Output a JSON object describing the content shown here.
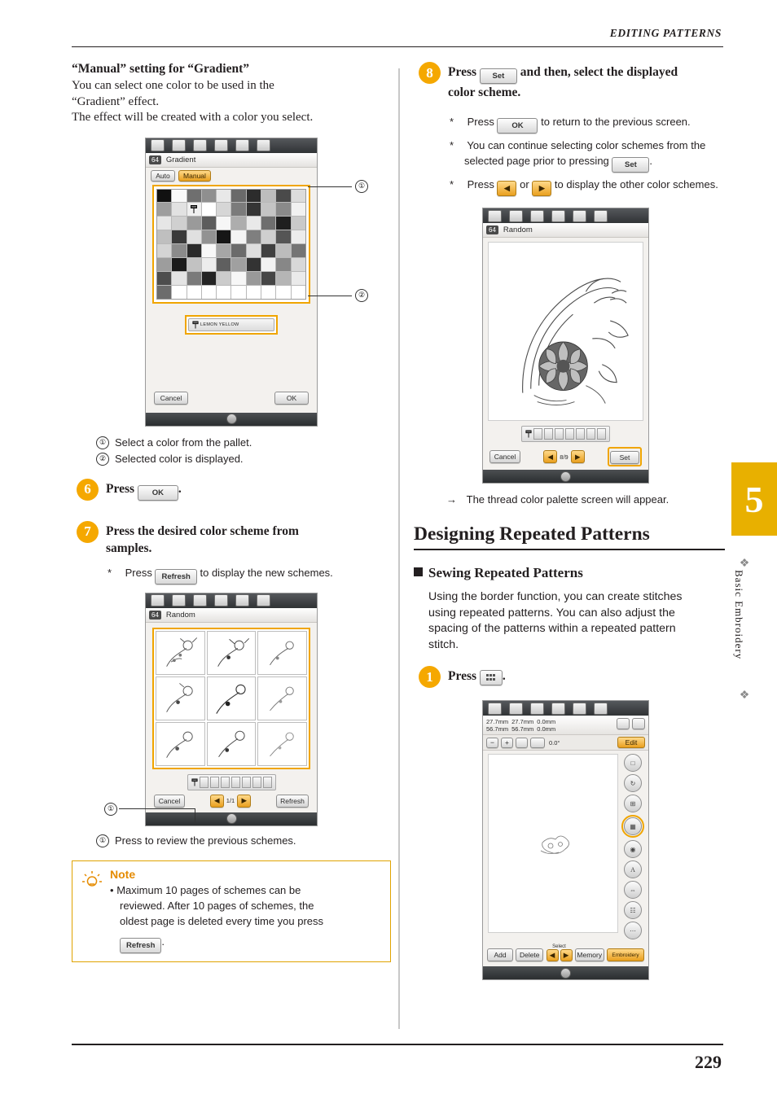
{
  "page": {
    "running_head": "EDITING PATTERNS",
    "folio": "229",
    "side_tab_number": "5",
    "side_tab_label": "Basic Embroidery"
  },
  "left_column": {
    "heading": "“Manual” setting for “Gradient”",
    "intro_line1": "You can select one color to be used in the",
    "intro_line2": "“Gradient” effect.",
    "intro_line3": "The effect will be created with a color you select.",
    "screenshot_gradient": {
      "title_badge": "64",
      "title_text": "Gradient",
      "mode_auto": "Auto",
      "mode_manual": "Manual",
      "selected_color_label": "LEMON YELLOW",
      "cancel_label": "Cancel",
      "ok_label": "OK"
    },
    "callouts": [
      {
        "num": "①",
        "text": "Select a color from the pallet."
      },
      {
        "num": "②",
        "text": "Selected color is displayed."
      }
    ],
    "step6": {
      "num": "6",
      "text_before": "Press",
      "chip": "OK",
      "text_after": "."
    },
    "step7": {
      "num": "7",
      "line1": "Press the desired color scheme from",
      "line2": "samples."
    },
    "step7_note": {
      "star": "*",
      "before": "Press",
      "chip": "Refresh",
      "after": "to display the new schemes."
    },
    "screenshot_random": {
      "title_badge": "64",
      "title_text": "Random",
      "cancel_label": "Cancel",
      "refresh_label": "Refresh",
      "page_indicator": "1/1",
      "prev_arrow": "◀",
      "next_arrow": "▶"
    },
    "callout_random": {
      "num": "①",
      "text": "Press to review the previous schemes."
    },
    "note": {
      "title": "Note",
      "bullet": "•",
      "line1": "Maximum 10 pages of schemes can be",
      "line2": "reviewed. After 10 pages of schemes, the",
      "line3": "oldest page is deleted every time you press",
      "chip": "Refresh",
      "end": "."
    }
  },
  "right_column": {
    "step8": {
      "num": "8",
      "before": "Press",
      "chip": "Set",
      "after": "and then, select the displayed",
      "line2": "color scheme."
    },
    "step8_notes": [
      {
        "star": "*",
        "before": "Press",
        "chip": "OK",
        "after": "to return to the previous screen."
      },
      {
        "star": "*",
        "line1": "You can continue selecting color schemes from the",
        "line2_before": "selected page prior to pressing",
        "chip": "Set",
        "line2_after": "."
      },
      {
        "star": "*",
        "before": "Press",
        "chip1": "◀",
        "mid": "or",
        "chip2": "▶",
        "after": "to display the other color schemes."
      }
    ],
    "screenshot_random_preview": {
      "title_badge": "64",
      "title_text": "Random",
      "cancel_label": "Cancel",
      "set_label": "Set",
      "page_indicator": "8/9",
      "prev_arrow": "◀",
      "next_arrow": "▶"
    },
    "arrow_note": {
      "arrow": "→",
      "text": "The thread color palette screen will appear."
    },
    "chapter_title": "Designing Repeated Patterns",
    "section_title": "Sewing Repeated Patterns",
    "section_body_l1": "Using the border function, you can create stitches",
    "section_body_l2": "using repeated patterns. You can also adjust the",
    "section_body_l3": "spacing of the patterns within a repeated pattern",
    "section_body_l4": "stitch.",
    "step1": {
      "num": "1",
      "before": "Press",
      "after": "."
    },
    "screenshot_edit": {
      "dim_width_1": "27.7mm",
      "dim_height_1": "56.7mm",
      "dim_width_2": "27.7mm",
      "dim_height_2": "56.7mm",
      "offset_x": "0.0mm",
      "offset_y": "0.0mm",
      "rotation": "0.0°",
      "edit_tab": "Edit",
      "add_label": "Add",
      "delete_label": "Delete",
      "select_label": "Select",
      "memory_label": "Memory",
      "embroidery_label": "Embroidery",
      "prev_arrow": "◀",
      "next_arrow": "▶"
    }
  },
  "colors": {
    "accent_amber": "#f5a800",
    "note_orange": "#e58b00",
    "tab_gold": "#e8b000",
    "ink": "#231f20"
  }
}
